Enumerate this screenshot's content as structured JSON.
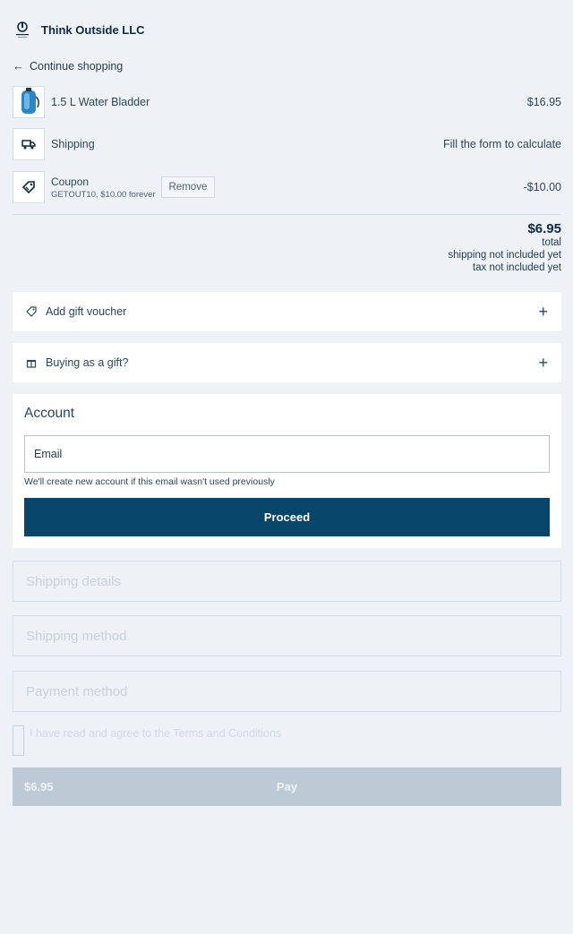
{
  "header": {
    "brand": "Think Outside LLC",
    "logo_icon": "brand-logo"
  },
  "nav": {
    "continue_label": "Continue shopping"
  },
  "cart": {
    "item": {
      "name": "1.5 L Water Bladder",
      "price": "$16.95"
    },
    "shipping": {
      "label": "Shipping",
      "value": "Fill the form to calculate"
    },
    "coupon": {
      "label": "Coupon",
      "code": "GETOUT10, $10.00 forever",
      "remove_label": "Remove",
      "value": "-$10.00"
    }
  },
  "totals": {
    "amount": "$6.95",
    "total_label": "total",
    "shipping_note": "shipping not included yet",
    "tax_note": "tax not included yet"
  },
  "gift_voucher": {
    "label": "Add gift voucher"
  },
  "buying_gift": {
    "label": "Buying as a gift?"
  },
  "account": {
    "title": "Account",
    "email_placeholder": "Email",
    "hint": "We'll create new account if this email wasn't used previously",
    "proceed_label": "Proceed"
  },
  "steps": {
    "shipping_details": "Shipping details",
    "shipping_method": "Shipping method",
    "payment_method": "Payment method"
  },
  "terms": {
    "label": "I have read and agree to the Terms and Conditions"
  },
  "pay": {
    "amount": "$6.95",
    "label": "Pay"
  },
  "colors": {
    "primary": "#07456b",
    "background": "#eef2f6",
    "disabled": "#bccad6"
  }
}
